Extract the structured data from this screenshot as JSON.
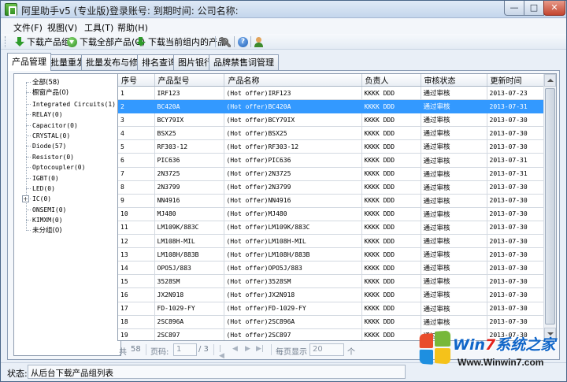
{
  "window": {
    "title": "阿里助手v5 (专业版)登录账号:     到期时间:     公司名称:",
    "min_glyph": "—",
    "max_glyph": "□",
    "close_glyph": "✕"
  },
  "menu": [
    "文件(F)",
    "视图(V)",
    "工具(T)",
    "帮助(H)"
  ],
  "toolbar": {
    "download_group": "下载产品组",
    "download_all": "下载全部产品(G)",
    "download_current": "下载当前组内的产品"
  },
  "tabs": [
    "产品管理",
    "批量重发",
    "批量发布与修改",
    "排名查询",
    "图片银行",
    "品牌禁售词管理"
  ],
  "tree": [
    {
      "label": "全部(58)",
      "expandable": false
    },
    {
      "label": "橱窗产品(0)",
      "expandable": false
    },
    {
      "label": "Integrated Circuits(1)",
      "expandable": false
    },
    {
      "label": "RELAY(0)",
      "expandable": false
    },
    {
      "label": "Capacitor(0)",
      "expandable": false
    },
    {
      "label": "CRYSTAL(0)",
      "expandable": false
    },
    {
      "label": "Diode(57)",
      "expandable": false
    },
    {
      "label": "Resistor(0)",
      "expandable": false
    },
    {
      "label": "Optocoupler(0)",
      "expandable": false
    },
    {
      "label": "IGBT(0)",
      "expandable": false
    },
    {
      "label": "LED(0)",
      "expandable": false
    },
    {
      "label": "IC(0)",
      "expandable": true
    },
    {
      "label": "ONSEMI(0)",
      "expandable": false
    },
    {
      "label": "KIMXM(0)",
      "expandable": false
    },
    {
      "label": "未分组(0)",
      "expandable": false
    }
  ],
  "grid": {
    "columns": [
      "序号",
      "产品型号",
      "产品名称",
      "负责人",
      "审核状态",
      "更新时间"
    ],
    "selected_row": 1,
    "rows": [
      [
        "1",
        "IRF123",
        "(Hot offer)IRF123",
        "KKKK DDD",
        "通过审核",
        "2013-07-23"
      ],
      [
        "2",
        "BC420A",
        "(Hot offer)BC420A",
        "KKKK DDD",
        "通过审核",
        "2013-07-31"
      ],
      [
        "3",
        "BCY79IX",
        "(Hot offer)BCY79IX",
        "KKKK DDD",
        "通过审核",
        "2013-07-30"
      ],
      [
        "4",
        "BSX25",
        "(Hot offer)BSX25",
        "KKKK DDD",
        "通过审核",
        "2013-07-30"
      ],
      [
        "5",
        "RF303-12",
        "(Hot offer)RF303-12",
        "KKKK DDD",
        "通过审核",
        "2013-07-30"
      ],
      [
        "6",
        "PIC636",
        "(Hot offer)PIC636",
        "KKKK DDD",
        "通过审核",
        "2013-07-31"
      ],
      [
        "7",
        "2N3725",
        "(Hot offer)2N3725",
        "KKKK DDD",
        "通过审核",
        "2013-07-31"
      ],
      [
        "8",
        "2N3799",
        "(Hot offer)2N3799",
        "KKKK DDD",
        "通过审核",
        "2013-07-30"
      ],
      [
        "9",
        "NN4916",
        "(Hot offer)NN4916",
        "KKKK DDD",
        "通过审核",
        "2013-07-30"
      ],
      [
        "10",
        "MJ480",
        "(Hot offer)MJ480",
        "KKKK DDD",
        "通过审核",
        "2013-07-30"
      ],
      [
        "11",
        "LM109K/883C",
        "(Hot offer)LM109K/883C",
        "KKKK DDD",
        "通过审核",
        "2013-07-30"
      ],
      [
        "12",
        "LM108H-MIL",
        "(Hot offer)LM108H-MIL",
        "KKKK DDD",
        "通过审核",
        "2013-07-30"
      ],
      [
        "13",
        "LM108H/883B",
        "(Hot offer)LM108H/883B",
        "KKKK DDD",
        "通过审核",
        "2013-07-30"
      ],
      [
        "14",
        "OPO5J/883",
        "(Hot offer)OPO5J/883",
        "KKKK DDD",
        "通过审核",
        "2013-07-30"
      ],
      [
        "15",
        "3528SM",
        "(Hot offer)3528SM",
        "KKKK DDD",
        "通过审核",
        "2013-07-30"
      ],
      [
        "16",
        "JX2N918",
        "(Hot offer)JX2N918",
        "KKKK DDD",
        "通过审核",
        "2013-07-30"
      ],
      [
        "17",
        "FD-1029-FY",
        "(Hot offer)FD-1029-FY",
        "KKKK DDD",
        "通过审核",
        "2013-07-30"
      ],
      [
        "18",
        "2SC896A",
        "(Hot offer)2SC896A",
        "KKKK DDD",
        "通过审核",
        "2013-07-30"
      ],
      [
        "19",
        "2SC897",
        "(Hot offer)2SC897",
        "KKKK DDD",
        "通过审核",
        "2013-07-30"
      ]
    ]
  },
  "pager": {
    "total_prefix": "共",
    "total": "58",
    "page_label": "页码:",
    "page_value": "1",
    "page_total": "/ 3",
    "per_page_label": "每页显示",
    "per_page_value": "20",
    "per_page_unit": "个"
  },
  "status": {
    "label": "状态:",
    "text": "从后台下载产品组列表"
  },
  "watermark": {
    "title_a": "Win",
    "title_b": "7",
    "title_c": "系统之家",
    "url": "Www.Winwin7.com"
  },
  "colors": {
    "selection": "#3399ff",
    "watermark_blue": "#0f65c8",
    "watermark_red": "#e2211c"
  }
}
